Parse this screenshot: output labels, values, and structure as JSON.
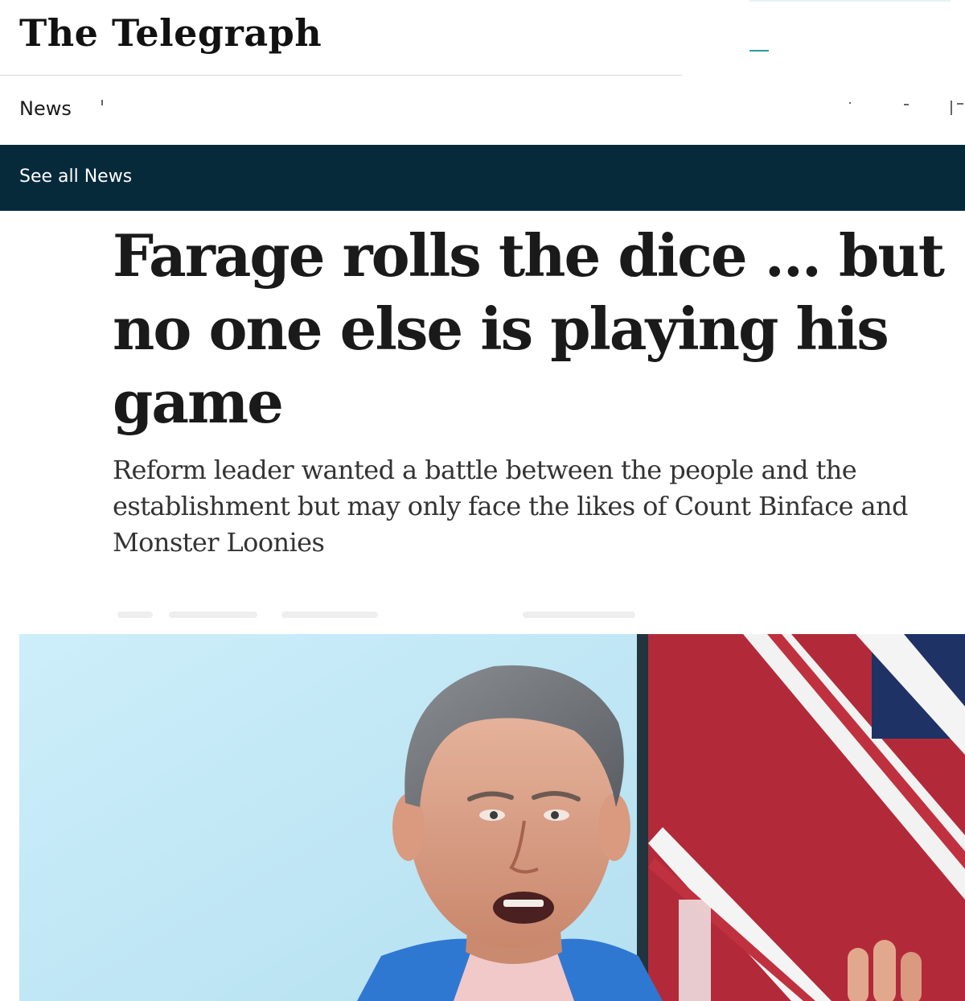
{
  "masthead": {
    "logo_text": "The Telegraph"
  },
  "nav": {
    "primary_item": "News"
  },
  "section_bar": {
    "link_label": "See all News",
    "background_color": "#072a3b"
  },
  "article": {
    "headline": "Farage rolls the dice ... but no one else is playing his game",
    "standfirst": "Reform leader wanted a battle between the people and the establishment but may only face the likes of Count Binface and Monster Loonies"
  },
  "hero_image": {
    "depicts": "photo",
    "colors": {
      "backdrop": "#bfe6f3",
      "flag_red": "#c0313f",
      "flag_white": "#f4f4f4",
      "jacket": "#2f78d2"
    }
  }
}
